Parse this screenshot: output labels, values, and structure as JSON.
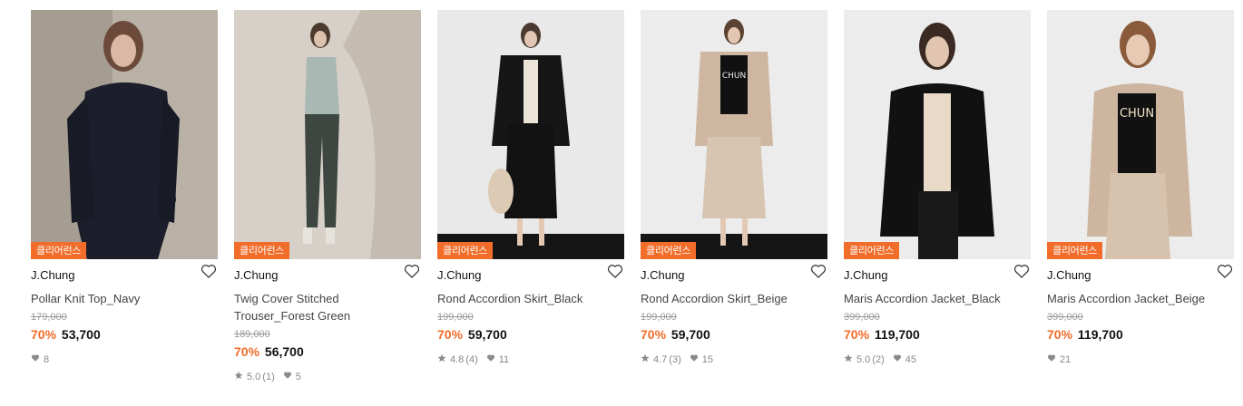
{
  "products": [
    {
      "badge": "클리어런스",
      "brand": "J.Chung",
      "name": "Pollar Knit Top_Navy",
      "original_price": "179,000",
      "discount": "70%",
      "price": "53,700",
      "rating": "",
      "reviews": "",
      "likes": "8"
    },
    {
      "badge": "클리어런스",
      "brand": "J.Chung",
      "name": "Twig Cover Stitched Trouser_Forest Green",
      "original_price": "189,000",
      "discount": "70%",
      "price": "56,700",
      "rating": "5.0",
      "reviews": "(1)",
      "likes": "5"
    },
    {
      "badge": "클리어런스",
      "brand": "J.Chung",
      "name": "Rond Accordion Skirt_Black",
      "original_price": "199,000",
      "discount": "70%",
      "price": "59,700",
      "rating": "4.8",
      "reviews": "(4)",
      "likes": "11"
    },
    {
      "badge": "클리어런스",
      "brand": "J.Chung",
      "name": "Rond Accordion Skirt_Beige",
      "original_price": "199,000",
      "discount": "70%",
      "price": "59,700",
      "rating": "4.7",
      "reviews": "(3)",
      "likes": "15"
    },
    {
      "badge": "클리어런스",
      "brand": "J.Chung",
      "name": "Maris Accordion Jacket_Black",
      "original_price": "399,000",
      "discount": "70%",
      "price": "119,700",
      "rating": "5.0",
      "reviews": "(2)",
      "likes": "45"
    },
    {
      "badge": "클리어런스",
      "brand": "J.Chung",
      "name": "Maris Accordion Jacket_Beige",
      "original_price": "399,000",
      "discount": "70%",
      "price": "119,700",
      "rating": "",
      "reviews": "",
      "likes": "21"
    }
  ],
  "icons": {
    "wishlist": "heart-outline-icon",
    "rating": "star-icon",
    "likes": "heart-filled-icon"
  },
  "colors": {
    "accent": "#f26c2a",
    "badge_bg": "#f26c2a",
    "muted": "#888888"
  }
}
